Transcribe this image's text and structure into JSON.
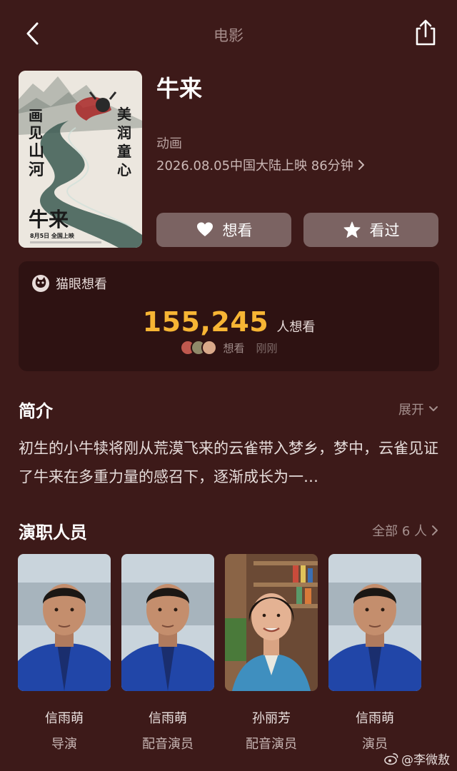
{
  "nav": {
    "title": "电影"
  },
  "poster": {
    "vertical_left": "画见山河",
    "vertical_right": "美润童心",
    "title": "牛来",
    "date_line": "8月5日  全国上映"
  },
  "movie": {
    "title": "牛来",
    "genre": "动画",
    "release": "2026.08.05中国大陆上映 86分钟"
  },
  "actions": {
    "want_label": "想看",
    "seen_label": "看过"
  },
  "maoyan": {
    "label": "猫眼想看",
    "count": "155,245",
    "unit": "人想看",
    "sub_label": "想看",
    "time": "刚刚"
  },
  "intro": {
    "title": "简介",
    "expand_label": "展开",
    "text": "初生的小牛犊将刚从荒漠飞来的云雀带入梦乡，梦中，云雀见证了牛来在多重力量的感召下，逐渐成长为一…"
  },
  "cast": {
    "title": "演职人员",
    "all_label": "全部 6 人",
    "members": [
      {
        "name": "信雨萌",
        "role": "导演"
      },
      {
        "name": "信雨萌",
        "role": "配音演员"
      },
      {
        "name": "孙丽芳",
        "role": "配音演员"
      },
      {
        "name": "信雨萌",
        "role": "演员"
      }
    ]
  },
  "watermark": {
    "text": "@李微敖"
  },
  "colors": {
    "background": "#3d1a19",
    "card": "#2e1212",
    "button": "#7b6362",
    "accent": "#f7b534"
  },
  "icons": [
    "back-arrow-icon",
    "share-icon",
    "heart-icon",
    "star-icon",
    "chevron-right-icon",
    "chevron-down-icon",
    "maoyan-cat-icon",
    "weibo-icon"
  ]
}
